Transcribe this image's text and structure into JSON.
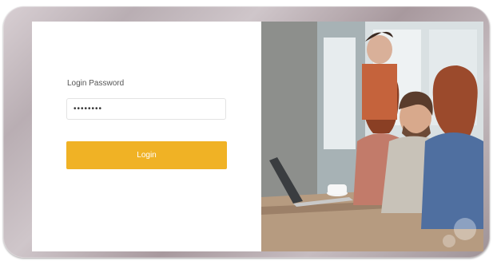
{
  "login_form": {
    "password_label": "Login Password",
    "password_value": "••••••••",
    "login_button_label": "Login"
  },
  "hero_image": {
    "description_icon": "team-working-photo"
  },
  "colors": {
    "accent": "#f0b225",
    "frame": "#b9aeb3"
  }
}
